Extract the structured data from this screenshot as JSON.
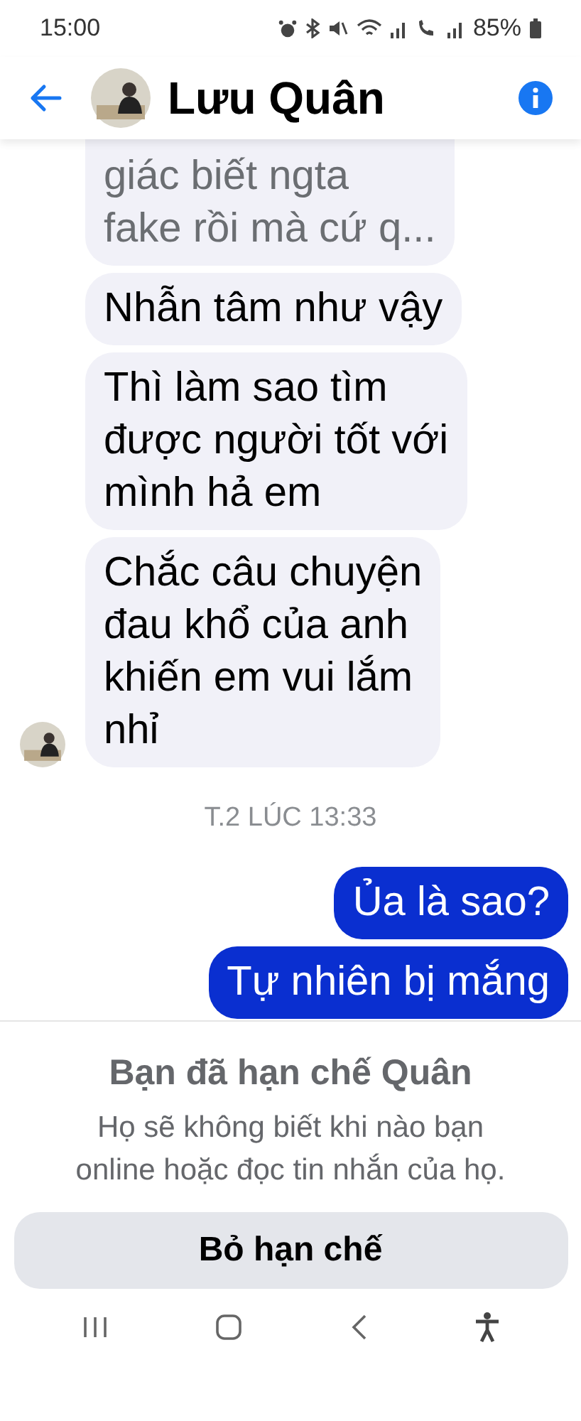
{
  "status_bar": {
    "time": "15:00",
    "battery": "85%"
  },
  "header": {
    "title": "Lưu Quân"
  },
  "messages": [
    {
      "kind": "incoming",
      "text": "giác biết ngta\nfake rồi mà cứ q...",
      "faded": true,
      "avatar": false
    },
    {
      "kind": "incoming",
      "text": "Nhẫn tâm như vậy",
      "faded": false,
      "avatar": false
    },
    {
      "kind": "incoming",
      "text": "Thì làm sao tìm\nđược người tốt với\nmình hả em",
      "faded": false,
      "avatar": false
    },
    {
      "kind": "incoming",
      "text": "Chắc câu chuyện\nđau khổ của anh\nkhiến em vui lắm\nnhỉ",
      "faded": false,
      "avatar": true
    },
    {
      "kind": "timestamp",
      "text": "T.2 LÚC 13:33"
    },
    {
      "kind": "outgoing",
      "text": "Ủa là sao?"
    },
    {
      "kind": "outgoing",
      "text": "Tự nhiên bị mắng"
    }
  ],
  "restricted_panel": {
    "title": "Bạn đã hạn chế Quân",
    "description": "Họ sẽ không biết khi nào bạn online hoặc đọc tin nhắn của họ.",
    "button": "Bỏ hạn chế"
  }
}
